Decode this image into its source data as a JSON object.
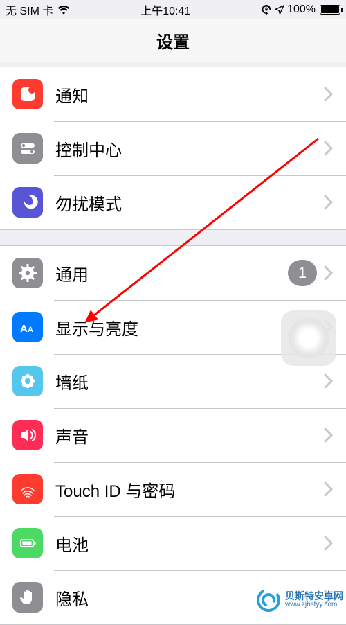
{
  "status_bar": {
    "carrier": "无 SIM 卡",
    "time": "上午10:41",
    "battery_pct": "100%"
  },
  "nav": {
    "title": "设置"
  },
  "groups": [
    {
      "items": [
        {
          "key": "notifications",
          "label": "通知",
          "icon": "notifications-icon",
          "color": "#ff3b30"
        },
        {
          "key": "control-center",
          "label": "控制中心",
          "icon": "toggles-icon",
          "color": "#8e8e93"
        },
        {
          "key": "dnd",
          "label": "勿扰模式",
          "icon": "moon-icon",
          "color": "#5856d6"
        }
      ]
    },
    {
      "items": [
        {
          "key": "general",
          "label": "通用",
          "icon": "gear-icon",
          "color": "#8e8e93",
          "badge": "1"
        },
        {
          "key": "display",
          "label": "显示与亮度",
          "icon": "text-size-icon",
          "color": "#007aff"
        },
        {
          "key": "wallpaper",
          "label": "墙纸",
          "icon": "flower-icon",
          "color": "#54c7ec"
        },
        {
          "key": "sounds",
          "label": "声音",
          "icon": "speaker-icon",
          "color": "#ff2d55"
        },
        {
          "key": "touchid",
          "label": "Touch ID 与密码",
          "icon": "fingerprint-icon",
          "color": "#ff3b30"
        },
        {
          "key": "battery",
          "label": "电池",
          "icon": "battery-icon",
          "color": "#4cd964"
        },
        {
          "key": "privacy",
          "label": "隐私",
          "icon": "hand-icon",
          "color": "#8e8e93"
        }
      ]
    }
  ],
  "watermark": {
    "line1": "贝斯特安卓网",
    "line2": "www.zjbstyy.com"
  },
  "annotation": {
    "arrow_target": "display"
  }
}
